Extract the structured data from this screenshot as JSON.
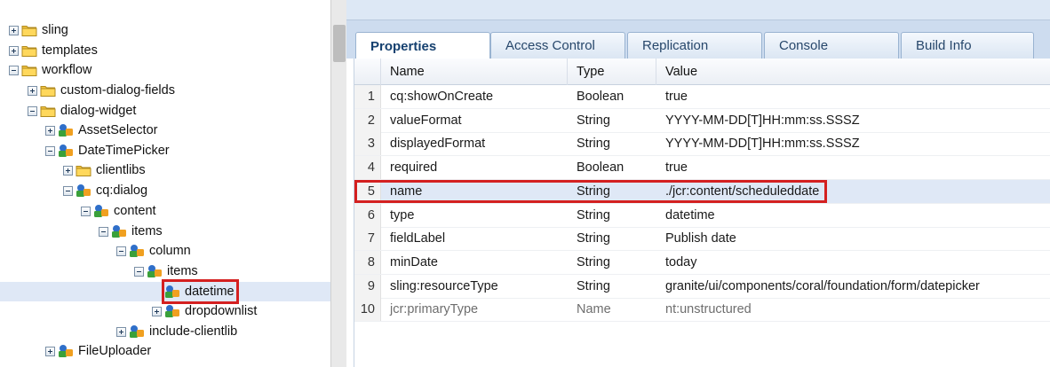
{
  "tree": {
    "nodes": [
      {
        "label": "sling",
        "expander": "plus",
        "icon": "folder-icon"
      },
      {
        "label": "templates",
        "expander": "plus",
        "icon": "folder-icon"
      },
      {
        "label": "workflow",
        "expander": "minus",
        "icon": "folder-icon"
      },
      {
        "label": "custom-dialog-fields",
        "expander": "plus",
        "icon": "folder-icon"
      },
      {
        "label": "dialog-widget",
        "expander": "minus",
        "icon": "folder-icon"
      },
      {
        "label": "AssetSelector",
        "expander": "plus",
        "icon": "component-node-icon"
      },
      {
        "label": "DateTimePicker",
        "expander": "minus",
        "icon": "component-node-icon"
      },
      {
        "label": "clientlibs",
        "expander": "plus",
        "icon": "folder-icon"
      },
      {
        "label": "cq:dialog",
        "expander": "minus",
        "icon": "component-node-icon"
      },
      {
        "label": "content",
        "expander": "minus",
        "icon": "component-node-icon"
      },
      {
        "label": "items",
        "expander": "minus",
        "icon": "component-node-icon"
      },
      {
        "label": "column",
        "expander": "minus",
        "icon": "component-node-icon"
      },
      {
        "label": "items",
        "expander": "minus",
        "icon": "component-node-icon"
      },
      {
        "label": "datetime",
        "expander": "none",
        "icon": "component-node-icon",
        "selected": true
      },
      {
        "label": "dropdownlist",
        "expander": "plus",
        "icon": "component-node-icon"
      },
      {
        "label": "include-clientlib",
        "expander": "plus",
        "icon": "component-node-icon"
      },
      {
        "label": "FileUploader",
        "expander": "plus",
        "icon": "component-node-icon"
      }
    ]
  },
  "tabs": [
    {
      "label": "Properties",
      "active": true
    },
    {
      "label": "Access Control"
    },
    {
      "label": "Replication"
    },
    {
      "label": "Console"
    },
    {
      "label": "Build Info"
    }
  ],
  "grid": {
    "columns": [
      "Name",
      "Type",
      "Value"
    ],
    "rows": [
      {
        "num": "1",
        "name": "cq:showOnCreate",
        "type": "Boolean",
        "value": "true"
      },
      {
        "num": "2",
        "name": "valueFormat",
        "type": "String",
        "value": "YYYY-MM-DD[T]HH:mm:ss.SSSZ"
      },
      {
        "num": "3",
        "name": "displayedFormat",
        "type": "String",
        "value": "YYYY-MM-DD[T]HH:mm:ss.SSSZ"
      },
      {
        "num": "4",
        "name": "required",
        "type": "Boolean",
        "value": "true"
      },
      {
        "num": "5",
        "name": "name",
        "type": "String",
        "value": "./jcr:content/scheduleddate",
        "selected": true
      },
      {
        "num": "6",
        "name": "type",
        "type": "String",
        "value": "datetime"
      },
      {
        "num": "7",
        "name": "fieldLabel",
        "type": "String",
        "value": "Publish date"
      },
      {
        "num": "8",
        "name": "minDate",
        "type": "String",
        "value": "today"
      },
      {
        "num": "9",
        "name": "sling:resourceType",
        "type": "String",
        "value": "granite/ui/components/coral/foundation/form/datepicker"
      },
      {
        "num": "10",
        "name": "jcr:primaryType",
        "type": "Name",
        "value": "nt:unstructured",
        "dim": true
      }
    ]
  },
  "colors": {
    "selection": "#dfe8f6",
    "highlight_border": "#d42020",
    "tab_text": "#27476b",
    "panel_header": "#cddcef"
  }
}
